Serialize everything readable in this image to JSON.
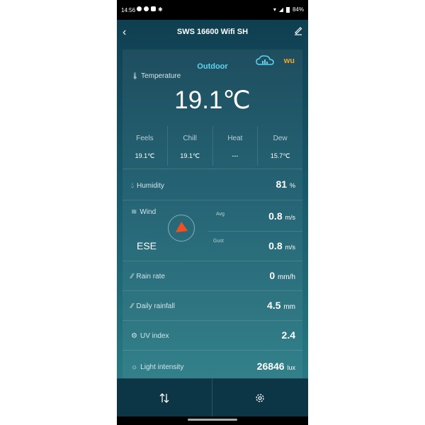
{
  "status": {
    "time": "14:56",
    "battery": "84%",
    "icons": [
      "facebook-icon",
      "facebook-icon",
      "youtube-icon",
      "bluetooth-icon"
    ]
  },
  "header": {
    "title": "SWS 16600 Wifi SH"
  },
  "panel": {
    "title": "Outdoor",
    "wu_logo": "wu",
    "temperature_label": "Temperature",
    "temperature": "19.1℃",
    "subs": [
      {
        "label": "Feels",
        "value": "19.1℃"
      },
      {
        "label": "Chill",
        "value": "19.1℃"
      },
      {
        "label": "Heat",
        "value": "---"
      },
      {
        "label": "Dew",
        "value": "15.7℃"
      }
    ],
    "humidity": {
      "label": "Humidity",
      "value": "81",
      "unit": "%"
    },
    "wind": {
      "label": "Wind",
      "direction": "ESE",
      "avg_label": "Avg",
      "avg": "0.8",
      "avg_unit": "m/s",
      "gust_label": "Gust",
      "gust": "0.8",
      "gust_unit": "m/s"
    },
    "rain_rate": {
      "label": "Rain rate",
      "value": "0",
      "unit": "mm/h"
    },
    "daily_rainfall": {
      "label": "Daily rainfall",
      "value": "4.5",
      "unit": "mm"
    },
    "uv_index": {
      "label": "UV index",
      "value": "2.4"
    },
    "light": {
      "label": "Light intensity",
      "value": "26846",
      "unit": "lux"
    }
  },
  "colors": {
    "accent": "#5fd3f0",
    "wind_arrow": "#f25022",
    "wu": "#f5a623"
  }
}
